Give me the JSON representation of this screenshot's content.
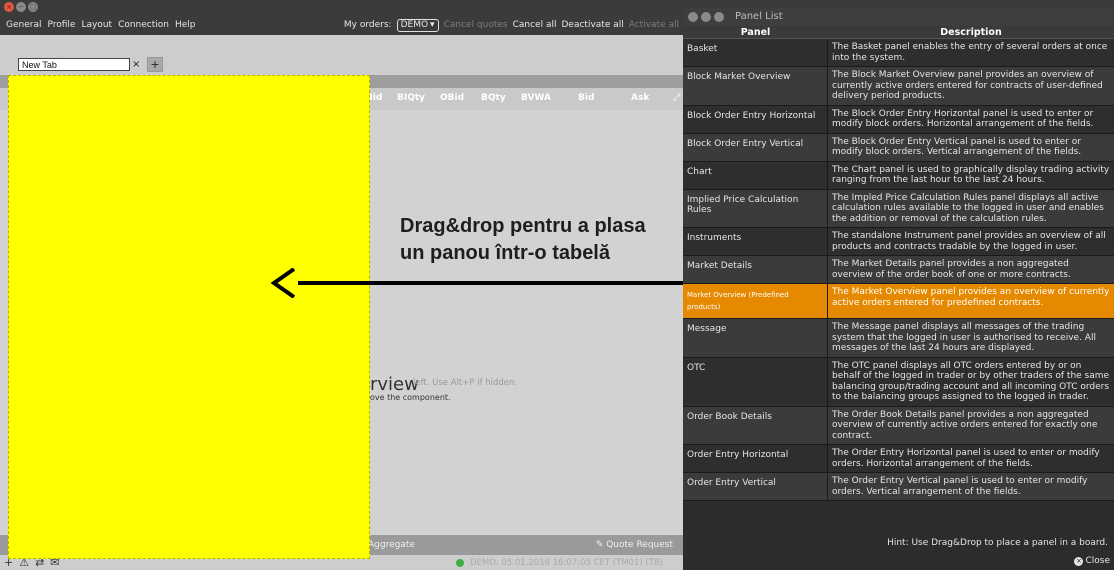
{
  "menu": [
    "General",
    "Profile",
    "Layout",
    "Connection",
    "Help"
  ],
  "orders": {
    "label": "My orders:",
    "selected": "DEMO",
    "cancel_quotes": "Cancel quotes",
    "cancel_all": "Cancel all",
    "deactivate_all": "Deactivate all",
    "activate_all": "Activate all"
  },
  "tab": {
    "name": "New Tab",
    "close": "×",
    "add": "+"
  },
  "columns": [
    "Bid",
    "BIQty",
    "OBid",
    "BQty",
    "BVWA",
    "Bid",
    "Ask"
  ],
  "drag_hint": "Drag&drop pentru a plasa un panou într-o tabelă",
  "market_overview": {
    "fragment": "rview",
    "hint": "left. Use Alt+P if hidden.",
    "sub": "ove the component."
  },
  "bottom": {
    "aggregate": "Aggregate",
    "quote_request": "Quote Request"
  },
  "status": {
    "text": "DEMO: 05.01.2016 16:07:05 CET (TM01) (T8)"
  },
  "panel_list": {
    "title": "Panel List",
    "header": {
      "panel": "Panel",
      "description": "Description"
    },
    "rows": [
      {
        "panel": "Basket",
        "description": "The Basket panel enables the entry of several orders at once into the system."
      },
      {
        "panel": "Block Market Overview",
        "description": "The Block Market Overview panel provides an overview of currently active orders entered for contracts of user-defined delivery period products."
      },
      {
        "panel": "Block Order Entry Horizontal",
        "description": "The Block Order Entry Horizontal panel is used to enter or modify block orders. Horizontal arrangement of the fields."
      },
      {
        "panel": "Block Order Entry Vertical",
        "description": "The Block Order Entry Vertical panel is used to enter or modify block orders. Vertical arrangement of the fields."
      },
      {
        "panel": "Chart",
        "description": "The Chart panel is used to graphically display trading activity ranging from the last hour to the last 24 hours."
      },
      {
        "panel": "Implied Price Calculation Rules",
        "description": "The Impled Price Calculation Rules panel displays all active calculation rules available to the logged in user and enables the addition or removal of the calculation rules."
      },
      {
        "panel": "Instruments",
        "description": "The standalone Instrument panel provides an overview of all products and contracts tradable by the logged in user."
      },
      {
        "panel": "Market Details",
        "description": "The Market Details panel provides a non aggregated overview of the order book of one or more contracts."
      },
      {
        "panel": "Market Overview (Predefined products)",
        "description": "The Market Overview panel provides an overview of currently active orders entered for predefined contracts."
      },
      {
        "panel": "Message",
        "description": "The Message panel displays all messages of the trading system that the logged in user is authorised to receive. All messages of the last 24 hours are displayed."
      },
      {
        "panel": "OTC",
        "description": "The OTC panel displays all OTC orders entered by or on behalf of the logged in trader or by other traders of the same balancing group/trading account and all incoming OTC orders to the balancing groups assigned to the logged in trader."
      },
      {
        "panel": "Order Book Details",
        "description": "The Order Book Details panel provides a non aggregated overview of currently active orders entered for exactly one contract."
      },
      {
        "panel": "Order Entry Horizontal",
        "description": "The Order Entry Horizontal panel is used to enter or modify orders. Horizontal arrangement of the fields."
      },
      {
        "panel": "Order Entry Vertical",
        "description": "The Order Entry Vertical panel is used to enter or modify orders. Vertical arrangement of the fields."
      }
    ],
    "hint": "Hint: Use Drag&Drop to place a panel in a board.",
    "close": "Close"
  },
  "colors": {
    "accent_selected": "#e58a00",
    "drop_overlay": "#ffff00"
  },
  "icons": [
    "close-window-icon",
    "minimize-icon",
    "maximize-icon",
    "arrow-left-icon",
    "quote-request-icon",
    "status-online-icon"
  ]
}
